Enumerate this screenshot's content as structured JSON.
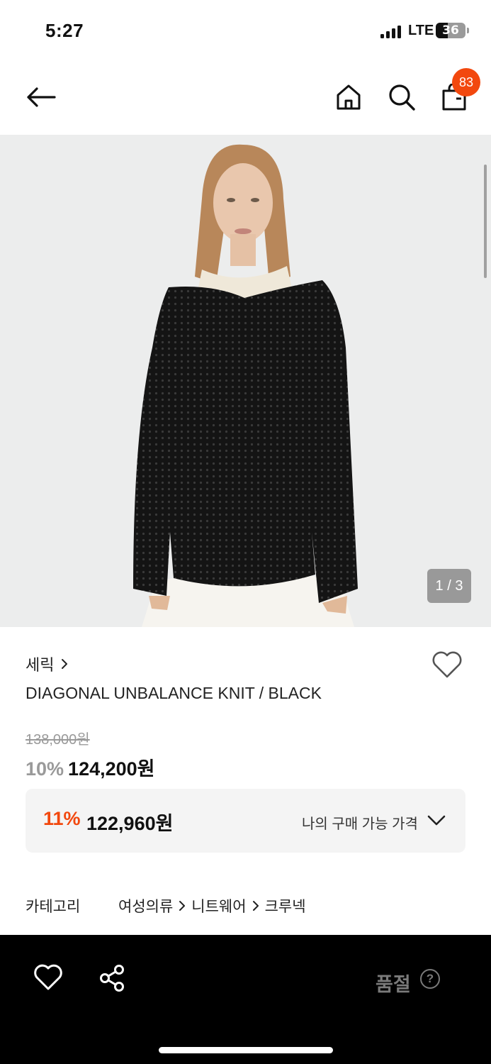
{
  "status_bar": {
    "time": "5:27",
    "network": "LTE",
    "battery": "36"
  },
  "nav": {
    "cart_count": "83"
  },
  "gallery": {
    "counter": "1 / 3"
  },
  "product": {
    "brand": "세릭",
    "name": "DIAGONAL UNBALANCE KNIT / BLACK",
    "original_price": "138,000원",
    "discount_rate": "10%",
    "sale_price": "124,200원"
  },
  "best_price": {
    "rate": "11%",
    "price": "122,960원",
    "label": "나의 구매 가능 가격"
  },
  "category": {
    "label": "카테고리",
    "path": [
      "여성의류",
      "니트웨어",
      "크루넥"
    ]
  },
  "bottom_bar": {
    "status": "품절",
    "help": "?"
  },
  "colors": {
    "accent": "#f2480e",
    "muted": "#9a9a9a",
    "bar_bg": "#000000"
  }
}
